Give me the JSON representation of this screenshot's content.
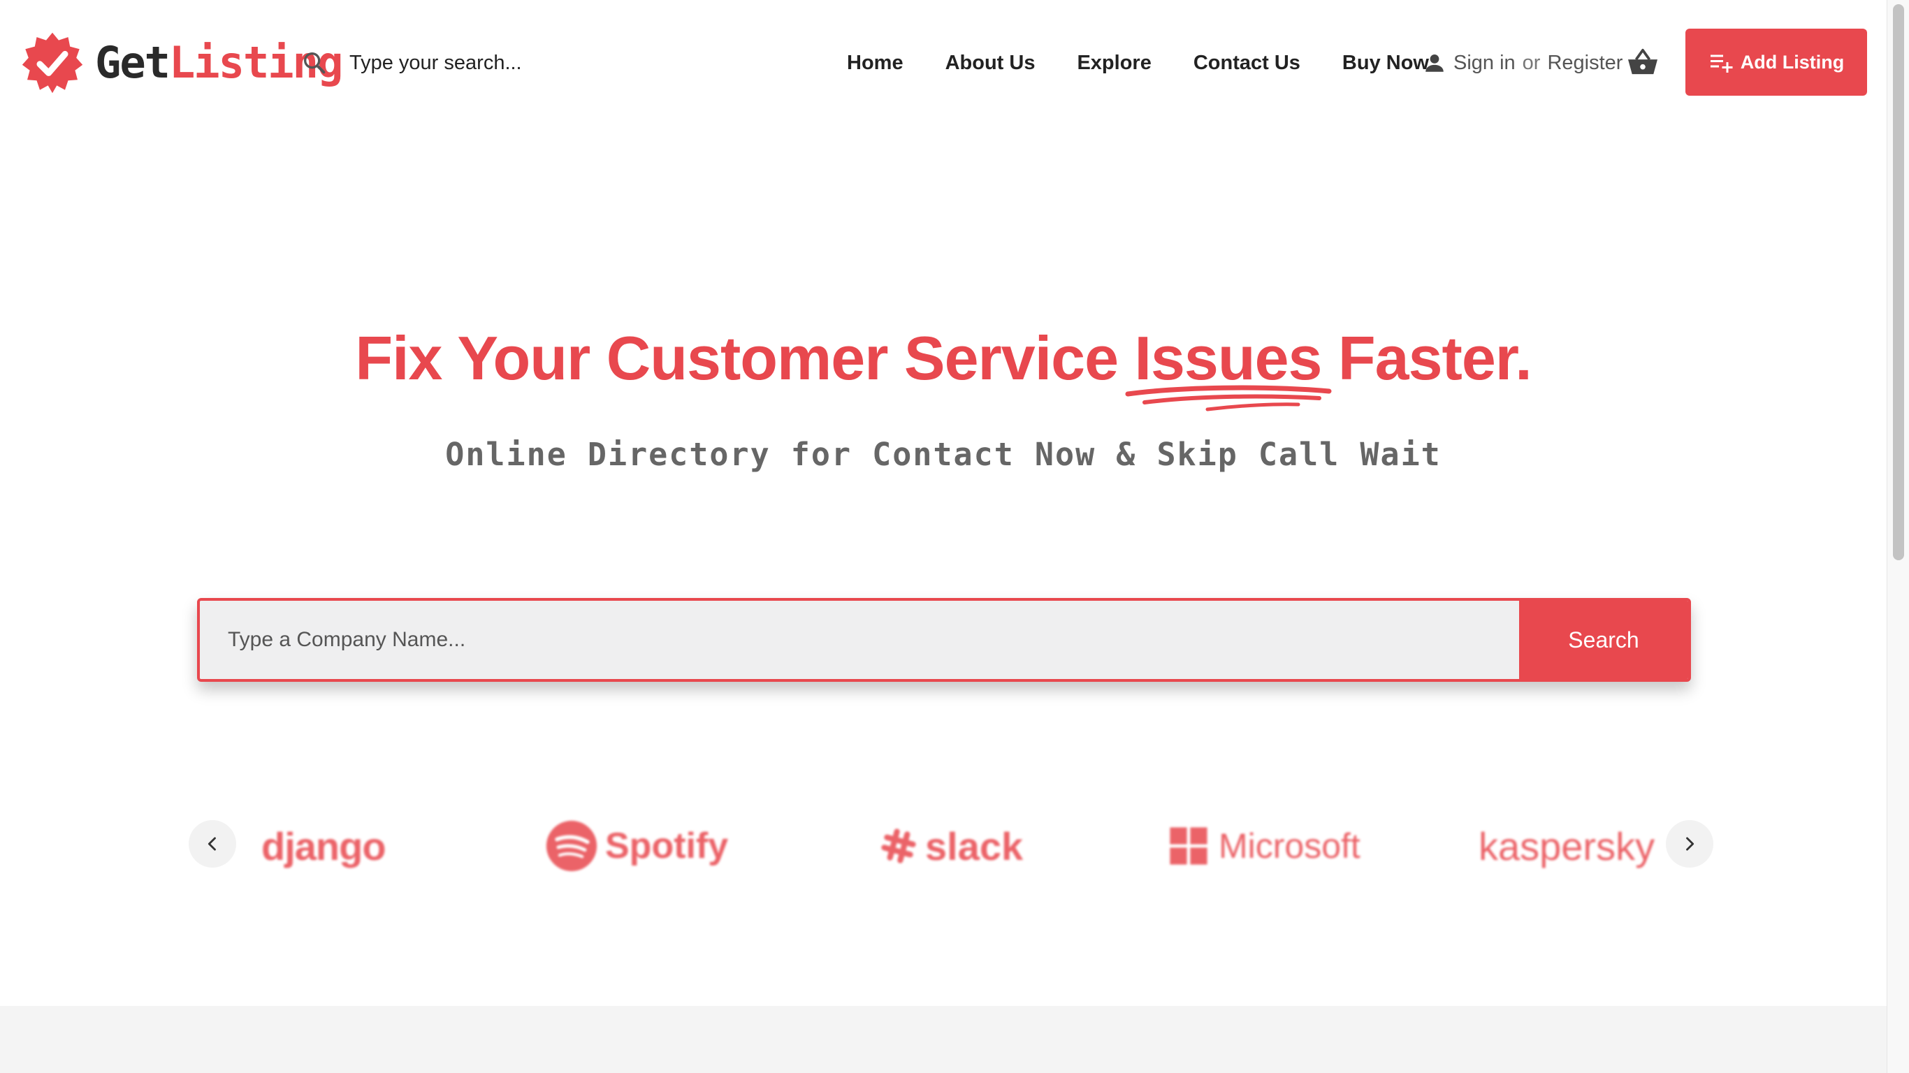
{
  "brand": {
    "logo_part1": "Get",
    "logo_part2": "Listing",
    "accent_color": "#e8484e"
  },
  "header": {
    "search_placeholder": "Type your search...",
    "nav": [
      "Home",
      "About Us",
      "Explore",
      "Contact Us",
      "Buy Now"
    ],
    "sign_in": "Sign in",
    "or": "or",
    "register": "Register",
    "add_listing": "Add Listing",
    "icons": [
      "search-icon",
      "user-icon",
      "basket-icon",
      "playlist-add-icon"
    ]
  },
  "hero": {
    "title_before": "Fix Your Customer Service",
    "title_highlight": "Issues",
    "title_after": "Faster.",
    "subtitle": "Online Directory for Contact Now & Skip Call Wait",
    "search_placeholder": "Type a Company Name...",
    "search_button": "Search"
  },
  "partners": [
    "django",
    "Spotify",
    "slack",
    "Microsoft",
    "kaspersky"
  ]
}
